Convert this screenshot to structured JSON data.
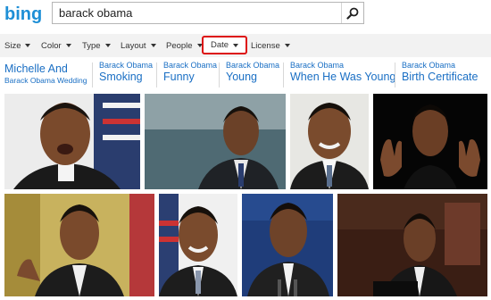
{
  "header": {
    "logo_text": "bing",
    "search_value": "barack obama",
    "search_icon": "search-icon"
  },
  "filters": [
    {
      "label": "Size"
    },
    {
      "label": "Color"
    },
    {
      "label": "Type"
    },
    {
      "label": "Layout"
    },
    {
      "label": "People"
    },
    {
      "label": "Date"
    },
    {
      "label": "License"
    }
  ],
  "related": [
    {
      "main": "Michelle And",
      "sub": "Barack Obama Wedding"
    },
    {
      "prefix": "Barack Obama",
      "main": "Smoking"
    },
    {
      "prefix": "Barack Obama",
      "main": "Funny"
    },
    {
      "prefix": "Barack Obama",
      "main": "Young"
    },
    {
      "prefix": "Barack Obama",
      "main": "When He Was Young"
    },
    {
      "prefix": "Barack Obama",
      "main": "Birth Certificate"
    }
  ],
  "colors": {
    "link": "#1a6fc4",
    "active_filter_border": "#dd1111",
    "filter_bar_bg": "#f2f2f2"
  }
}
